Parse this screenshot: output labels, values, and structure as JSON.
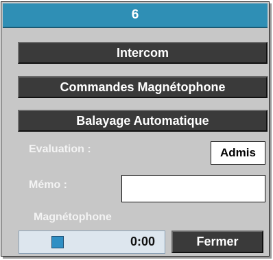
{
  "dialog": {
    "title": "6",
    "buttons": {
      "intercom": "Intercom",
      "recorder_commands": "Commandes Magnétophone",
      "auto_scan": "Balayage Automatique",
      "close": "Fermer"
    },
    "evaluation": {
      "label": "Evaluation :",
      "value": "Admis"
    },
    "memo": {
      "label": "Mémo :",
      "value": ""
    },
    "recorder": {
      "label": "Magnétophone",
      "time": "0:00"
    }
  },
  "colors": {
    "title_bar": "#2f8fb5",
    "panel": "#c7c7c7",
    "dark_button": "#3a3a3a",
    "record_indicator": "#2f8fc4"
  }
}
